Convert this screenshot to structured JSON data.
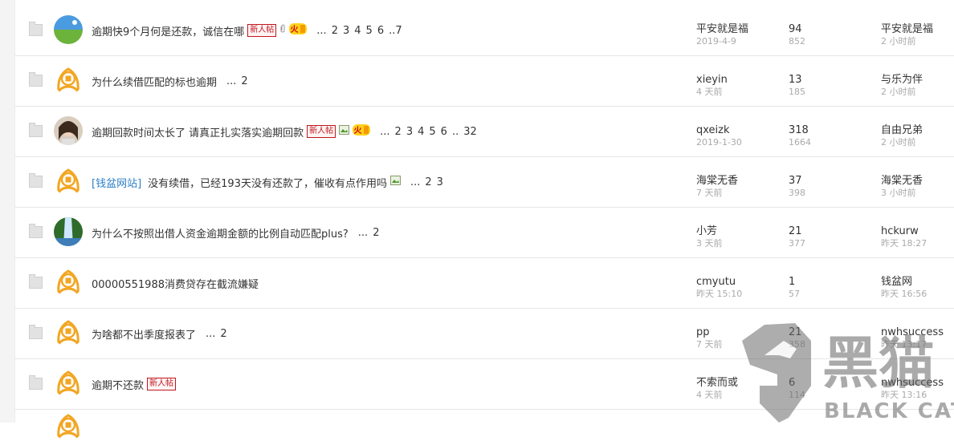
{
  "colors": {
    "tag_red": "#c0161d",
    "link_blue": "#2b7fc6",
    "text": "#333333",
    "muted": "#aaaaaa",
    "orange_avatar": "#f2a623"
  },
  "threads": [
    {
      "avatar": "landscape-avatar",
      "title": "逾期快9个月何是还款，诚信在哪",
      "tag": "新人帖",
      "icons": [
        "attachment-icon",
        "hot-icon"
      ],
      "hot": "火",
      "pages": [
        "...",
        "2",
        "3",
        "4",
        "5",
        "6",
        "..7"
      ],
      "author": "平安就是福",
      "date": "2019-4-9",
      "replies": "94",
      "views": "852",
      "last_user": "平安就是福",
      "last_time": "2 小时前"
    },
    {
      "avatar": "default-orange-avatar",
      "title": "为什么续借匹配的标也逾期",
      "pages": [
        "...",
        "2"
      ],
      "author": "xieyin",
      "date": "4 天前",
      "replies": "13",
      "views": "185",
      "last_user": "与乐为伴",
      "last_time": "2 小时前"
    },
    {
      "avatar": "girl-photo-avatar",
      "title": "逾期回款时间太长了 请真正扎实落实逾期回款",
      "tag": "新人帖",
      "icons": [
        "image-icon",
        "hot-icon"
      ],
      "hot": "火",
      "pages": [
        "...",
        "2",
        "3",
        "4",
        "5",
        "6",
        "..",
        "32"
      ],
      "author": "qxeizk",
      "date": "2019-1-30",
      "replies": "318",
      "views": "1664",
      "last_user": "自由兄弟",
      "last_time": "2 小时前"
    },
    {
      "avatar": "default-orange-avatar",
      "prefix": "[钱盆网站]",
      "title": "没有续借，已经193天没有还款了，催收有点作用吗",
      "icons": [
        "image-icon"
      ],
      "pages": [
        "...",
        "2",
        "3"
      ],
      "author": "海棠无香",
      "date": "7 天前",
      "replies": "37",
      "views": "398",
      "last_user": "海棠无香",
      "last_time": "3 小时前"
    },
    {
      "avatar": "waterfall-avatar",
      "title": "为什么不按照出借人资金逾期金额的比例自动匹配plus?",
      "pages": [
        "...",
        "2"
      ],
      "author": "小芳",
      "date": "3 天前",
      "replies": "21",
      "views": "377",
      "last_user": "hckurw",
      "last_time": "昨天 18:27"
    },
    {
      "avatar": "default-orange-avatar",
      "title": "00000551988消费贷存在截流嫌疑",
      "pages": [],
      "author": "cmyutu",
      "date": "昨天 15:10",
      "replies": "1",
      "views": "57",
      "last_user": "钱盆网",
      "last_time": "昨天 16:56"
    },
    {
      "avatar": "default-orange-avatar",
      "title": "为啥都不出季度报表了",
      "pages": [
        "...",
        "2"
      ],
      "author": "pp",
      "date": "7 天前",
      "replies": "21",
      "views": "358",
      "last_user": "nwhsuccess",
      "last_time": "昨天 13:17"
    },
    {
      "avatar": "default-orange-avatar",
      "title": "逾期不还款",
      "tag": "新人帖",
      "pages": [],
      "author": "不索而或",
      "date": "4 天前",
      "replies": "6",
      "views": "114",
      "last_user": "nwhsuccess",
      "last_time": "昨天 13:16"
    }
  ],
  "watermark": {
    "name": "黑猫",
    "sub": "BLACK CAT"
  }
}
